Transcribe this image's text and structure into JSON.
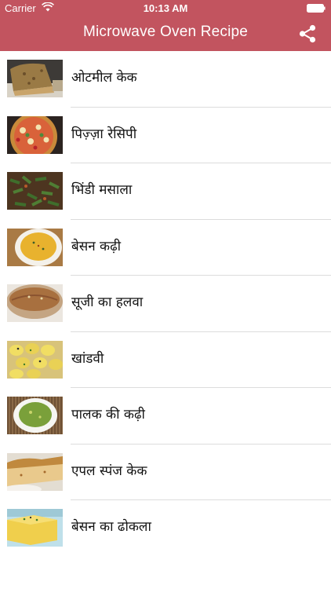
{
  "status_bar": {
    "carrier": "Carrier",
    "time": "10:13 AM"
  },
  "header": {
    "title": "Microwave Oven Recipe",
    "share_icon": "share-icon",
    "color": "#c2545f"
  },
  "recipes": [
    {
      "label": "ओटमील केक",
      "icon": "oatmeal-cake-thumbnail"
    },
    {
      "label": "पिज़्ज़ा रेसिपी",
      "icon": "pizza-thumbnail"
    },
    {
      "label": "भिंडी मसाला",
      "icon": "bhindi-masala-thumbnail"
    },
    {
      "label": "बेसन कढ़ी",
      "icon": "besan-kadhi-thumbnail"
    },
    {
      "label": "सूजी का हलवा",
      "icon": "suji-halwa-thumbnail"
    },
    {
      "label": "खांडवी",
      "icon": "khandvi-thumbnail"
    },
    {
      "label": "पालक की कढ़ी",
      "icon": "palak-kadhi-thumbnail"
    },
    {
      "label": "एपल स्पंज केक",
      "icon": "apple-sponge-cake-thumbnail"
    },
    {
      "label": " बेसन का ढोकला",
      "icon": "besan-dhokla-thumbnail"
    }
  ]
}
